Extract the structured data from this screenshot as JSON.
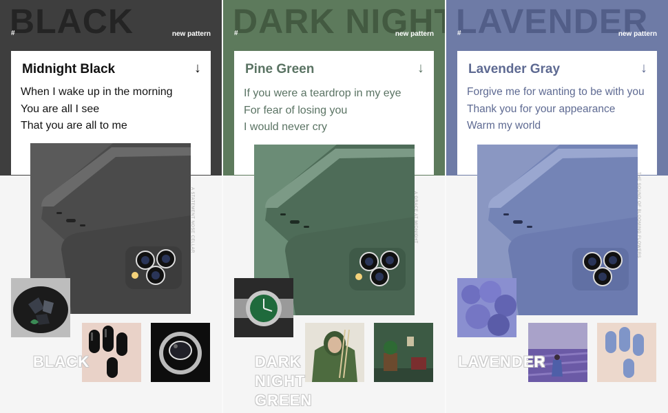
{
  "panels": [
    {
      "bigword": "BLACK",
      "hash": "#",
      "new_pattern": "new pattern",
      "title": "Midnight Black",
      "arrow": "↓",
      "lyrics": [
        "When I wake up in the morning",
        "You are all I see",
        "That you are all to me"
      ],
      "side_text": "A STATEMENT NOSE CELLAR",
      "word_lines": [
        "BLACK"
      ],
      "colors": {
        "band": "#3e3e3e",
        "text": "#111111",
        "phone": "#4a4a4a"
      }
    },
    {
      "bigword": "DARK NIGHT",
      "hash": "#",
      "new_pattern": "new pattern",
      "title": "Pine Green",
      "arrow": "↓",
      "lyrics": [
        "If you were a teardrop in my eye",
        "For fear of losing you",
        "I would never cry"
      ],
      "side_text": "A GRACE AT MIDNIGHT",
      "word_lines": [
        "DARK",
        "NIGHT",
        "GREEN"
      ],
      "colors": {
        "band": "#5d7a5c",
        "text": "#5a7363",
        "phone": "#4c6b55"
      }
    },
    {
      "bigword": "LAVENDER",
      "hash": "#",
      "new_pattern": "new pattern",
      "title": "Lavender Gray",
      "arrow": "↓",
      "lyrics": [
        "Forgive me for wanting to be with you",
        "Thank you for your appearance",
        "Warm my world"
      ],
      "side_text": "THE SOUND OF BLOOMING FLOWERS",
      "word_lines": [
        "LAVENDER"
      ],
      "colors": {
        "band": "#6e7ba6",
        "text": "#5e6a92",
        "phone": "#7b8ab8"
      }
    }
  ]
}
